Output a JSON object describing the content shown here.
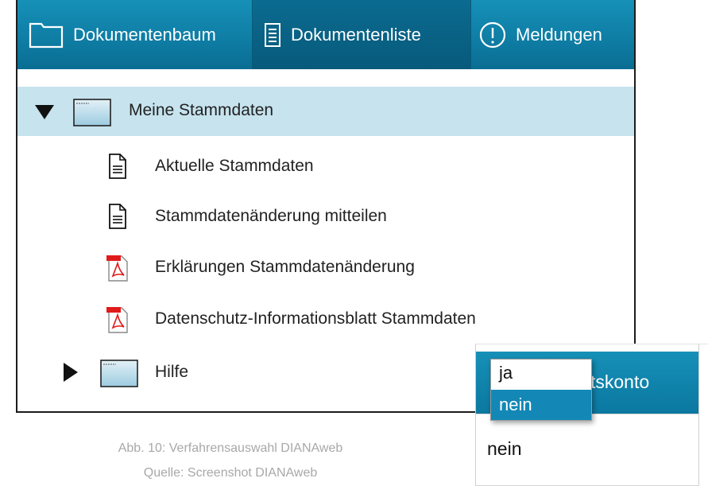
{
  "tabs": [
    {
      "label": "Dokumentenbaum",
      "icon": "folder-icon"
    },
    {
      "label": "Dokumentenliste",
      "icon": "document-list-icon"
    },
    {
      "label": "Meldungen",
      "icon": "exclamation-circle-icon"
    }
  ],
  "tree": {
    "root": {
      "label": "Meine Stammdaten",
      "icon": "folder-icon",
      "expanded": true
    },
    "children": [
      {
        "label": "Aktuelle Stammdaten",
        "icon": "document-icon"
      },
      {
        "label": "Stammdatenänderung mitteilen",
        "icon": "document-icon"
      },
      {
        "label": "Erklärungen Stammdatenänderung",
        "icon": "pdf-icon"
      },
      {
        "label": "Datenschutz-Informationsblatt Stammdaten",
        "icon": "pdf-icon"
      }
    ],
    "sibling": {
      "label": "Hilfe",
      "icon": "folder-icon",
      "expanded": false
    }
  },
  "caption": {
    "line1": "Abb. 10: Verfahrensauswahl DIANAweb",
    "line2": "Quelle: Screenshot DIANAweb"
  },
  "inset": {
    "header_text": "tskonto",
    "cell_value": "nein",
    "dropdown": {
      "options": [
        "ja",
        "nein"
      ],
      "selected": "nein"
    }
  },
  "colors": {
    "tab_bar": "#0f7ea5",
    "active_tab": "#075a7b",
    "selected_row": "#c6e3ee",
    "dropdown_highlight": "#1388b6",
    "caption": "#a8a8a8"
  }
}
